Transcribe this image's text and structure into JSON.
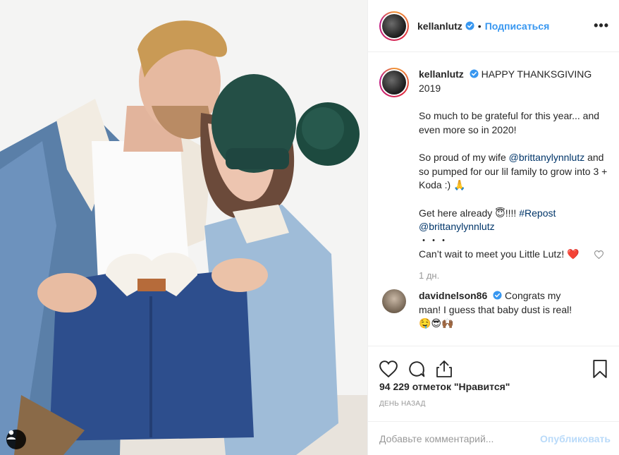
{
  "post": {
    "username": "kellanlutz",
    "dot": "•",
    "follow_label": "Подписаться",
    "more_label": "•••"
  },
  "caption": {
    "username": "kellanlutz",
    "line1": "HAPPY THANKSGIVING 2019",
    "line2": "So much to be grateful for this year... and even more so in 2020!",
    "line3_pre": "So proud of my wife ",
    "line3_mention": "@brittanylynnlutz",
    "line3_post": " and so pumped for our lil family to grow into 3 + Koda :) 🙏",
    "line4_pre": "Get here already 😇!!!! ",
    "line4_tag": "#Repost",
    "line4_mention": "@brittanylynnlutz",
    "line5": "・・・",
    "line6": "Can’t wait to meet you Little Lutz! ❤️",
    "time": "1 дн."
  },
  "comment": {
    "username": "davidnelson86",
    "text": "Congrats my man! I guess that baby dust is real! 🤤😎🙌🏾"
  },
  "stats": {
    "likes": "94 229 отметок \"Нравится\"",
    "date": "день назад"
  },
  "comment_input": {
    "placeholder": "Добавьте комментарий...",
    "publish_label": "Опубликовать"
  },
  "colors": {
    "accent": "#3897f0",
    "verified": "#3897f0",
    "heart": "#ed4956"
  },
  "icons": {
    "verified": "verified-badge-icon",
    "like": "heart-icon",
    "comment": "comment-icon",
    "share": "share-icon",
    "save": "bookmark-icon",
    "tag": "user-tag-icon"
  }
}
